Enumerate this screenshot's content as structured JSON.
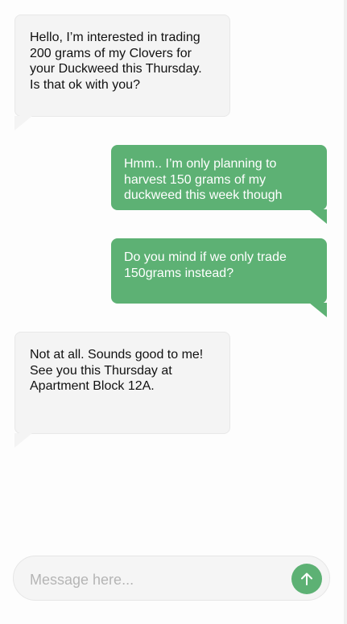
{
  "messages": [
    {
      "sender": "other",
      "text": "Hello, I’m interested in trading\n200 grams of my Clovers for\nyour Duckweed this Thursday.\nIs that ok with you?"
    },
    {
      "sender": "me",
      "text": "Hmm.. I’m only planning to\nharvest 150 grams of my\nduckweed this week though"
    },
    {
      "sender": "me",
      "text": "Do you mind if we only trade\n150grams instead?"
    },
    {
      "sender": "other",
      "text": "Not at all. Sounds good to me!\nSee you this Thursday at\nApartment Block 12A."
    }
  ],
  "composer": {
    "placeholder": "Message here...",
    "value": "",
    "send_icon": "arrow-up-icon"
  },
  "colors": {
    "sent_bubble": "#5db174",
    "received_bubble": "#f4f4f4",
    "send_button": "#5db174"
  }
}
